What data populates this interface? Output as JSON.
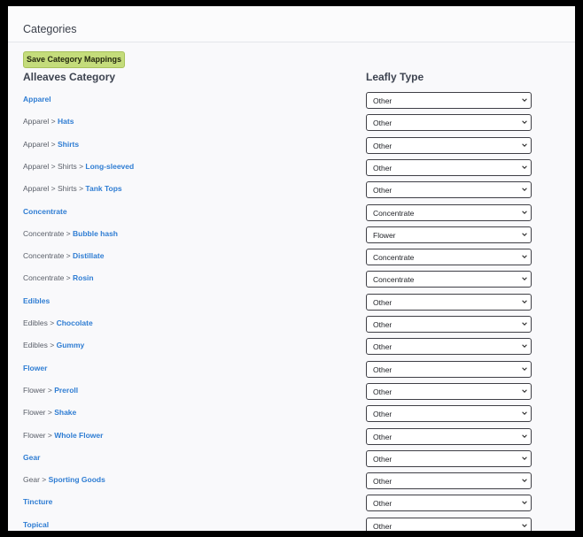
{
  "panel": {
    "title": "Categories"
  },
  "toolbar": {
    "save_label": "Save Category Mappings"
  },
  "columns": {
    "left": "Alleaves Category",
    "right": "Leafly Type"
  },
  "rows": [
    {
      "prefix": "",
      "name": "Apparel",
      "type": "Other"
    },
    {
      "prefix": "Apparel > ",
      "name": "Hats",
      "type": "Other"
    },
    {
      "prefix": "Apparel > ",
      "name": "Shirts",
      "type": "Other"
    },
    {
      "prefix": "Apparel > Shirts > ",
      "name": "Long-sleeved",
      "type": "Other"
    },
    {
      "prefix": "Apparel > Shirts > ",
      "name": "Tank Tops",
      "type": "Other"
    },
    {
      "prefix": "",
      "name": "Concentrate",
      "type": "Concentrate"
    },
    {
      "prefix": "Concentrate > ",
      "name": "Bubble hash",
      "type": "Flower"
    },
    {
      "prefix": "Concentrate > ",
      "name": "Distillate",
      "type": "Concentrate"
    },
    {
      "prefix": "Concentrate > ",
      "name": "Rosin",
      "type": "Concentrate"
    },
    {
      "prefix": "",
      "name": "Edibles",
      "type": "Other"
    },
    {
      "prefix": "Edibles > ",
      "name": "Chocolate",
      "type": "Other"
    },
    {
      "prefix": "Edibles > ",
      "name": "Gummy",
      "type": "Other"
    },
    {
      "prefix": "",
      "name": "Flower",
      "type": "Other"
    },
    {
      "prefix": "Flower > ",
      "name": "Preroll",
      "type": "Other"
    },
    {
      "prefix": "Flower > ",
      "name": "Shake",
      "type": "Other"
    },
    {
      "prefix": "Flower > ",
      "name": "Whole Flower",
      "type": "Other"
    },
    {
      "prefix": "",
      "name": "Gear",
      "type": "Other"
    },
    {
      "prefix": "Gear > ",
      "name": "Sporting Goods",
      "type": "Other"
    },
    {
      "prefix": "",
      "name": "Tincture",
      "type": "Other"
    },
    {
      "prefix": "",
      "name": "Topical",
      "type": "Other"
    }
  ],
  "icons": {
    "select_arrow": "chevron-down-icon"
  },
  "colors": {
    "link": "#2f7dd3",
    "button": "#c4dc7b"
  }
}
